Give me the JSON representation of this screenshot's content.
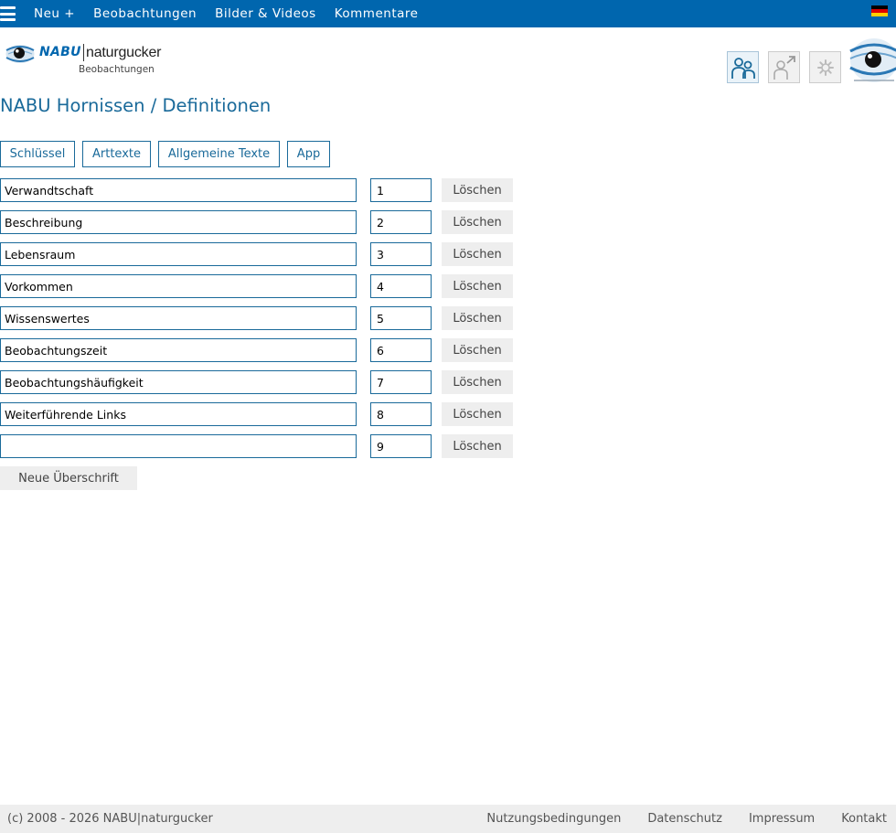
{
  "topnav": {
    "items": [
      "Neu +",
      "Beobachtungen",
      "Bilder & Videos",
      "Kommentare"
    ]
  },
  "brand": {
    "nabu": "NABU",
    "naturgucker": "naturgucker",
    "subtitle": "Beobachtungen"
  },
  "icons": {
    "menu": "hamburger-menu-icon",
    "language": "german-flag-icon",
    "users": "users-icon",
    "share": "user-share-icon",
    "settings": "gear-icon"
  },
  "colors": {
    "nav_bar": "#0066ae",
    "accent": "#1a6a9a",
    "button_bg": "#eeeeee",
    "footer_bg": "#eeeeee"
  },
  "page": {
    "title": "NABU Hornissen / Definitionen"
  },
  "tabs": [
    "Schlüssel",
    "Arttexte",
    "Allgemeine Texte",
    "App"
  ],
  "rows": [
    {
      "name": "Verwandtschaft",
      "order": "1"
    },
    {
      "name": "Beschreibung",
      "order": "2"
    },
    {
      "name": "Lebensraum",
      "order": "3"
    },
    {
      "name": "Vorkommen",
      "order": "4"
    },
    {
      "name": "Wissenswertes",
      "order": "5"
    },
    {
      "name": "Beobachtungszeit",
      "order": "6"
    },
    {
      "name": "Beobachtungshäufigkeit",
      "order": "7"
    },
    {
      "name": "Weiterführende Links",
      "order": "8"
    },
    {
      "name": "",
      "order": "9"
    }
  ],
  "actions": {
    "delete_label": "Löschen",
    "new_heading_label": "Neue Überschrift"
  },
  "footer": {
    "copyright": "(c) 2008 - 2026 NABU|naturgucker",
    "links": [
      "Nutzungsbedingungen",
      "Datenschutz",
      "Impressum",
      "Kontakt"
    ]
  }
}
